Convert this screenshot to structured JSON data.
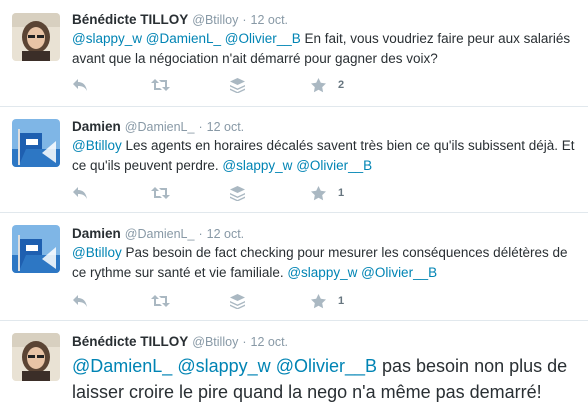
{
  "tweets": [
    {
      "name": "Bénédicte TILLOY",
      "handle": "@Btilloy",
      "time": "12 oct.",
      "text_parts": [
        {
          "t": "@slappy_w",
          "mention": true
        },
        {
          "t": " ",
          "mention": false
        },
        {
          "t": "@DamienL_",
          "mention": true
        },
        {
          "t": " ",
          "mention": false
        },
        {
          "t": "@Olivier__B",
          "mention": true
        },
        {
          "t": " En fait, vous voudriez faire peur aux salariés avant que la négociation n'ait démarré pour gagner des voix?",
          "mention": false
        }
      ],
      "favorite_count": "2",
      "retweet_count": "",
      "avatar": "woman-avatar",
      "large": false
    },
    {
      "name": "Damien",
      "handle": "@DamienL_",
      "time": "12 oct.",
      "text_parts": [
        {
          "t": "@Btilloy",
          "mention": true
        },
        {
          "t": " Les agents en horaires décalés savent très bien ce qu'ils subissent déjà. Et ce qu'ils peuvent perdre. ",
          "mention": false
        },
        {
          "t": "@slappy_w",
          "mention": true
        },
        {
          "t": " ",
          "mention": false
        },
        {
          "t": "@Olivier__B",
          "mention": true
        }
      ],
      "favorite_count": "1",
      "retweet_count": "",
      "avatar": "flag-avatar",
      "large": false
    },
    {
      "name": "Damien",
      "handle": "@DamienL_",
      "time": "12 oct.",
      "text_parts": [
        {
          "t": "@Btilloy",
          "mention": true
        },
        {
          "t": " Pas besoin de fact checking pour mesurer les conséquences délétères de ce rythme sur santé et vie familiale. ",
          "mention": false
        },
        {
          "t": "@slappy_w",
          "mention": true
        },
        {
          "t": " ",
          "mention": false
        },
        {
          "t": "@Olivier__B",
          "mention": true
        }
      ],
      "favorite_count": "1",
      "retweet_count": "",
      "avatar": "flag-avatar",
      "large": false
    },
    {
      "name": "Bénédicte TILLOY",
      "handle": "@Btilloy",
      "time": "12 oct.",
      "text_parts": [
        {
          "t": "@DamienL_",
          "mention": true
        },
        {
          "t": " ",
          "mention": false
        },
        {
          "t": "@slappy_w",
          "mention": true
        },
        {
          "t": " ",
          "mention": false
        },
        {
          "t": "@Olivier__B",
          "mention": true
        },
        {
          "t": " pas besoin non plus de laisser croire le pire quand la nego n'a même pas demarré!",
          "mention": false
        }
      ],
      "favorite_count": "",
      "retweet_count": "",
      "avatar": "woman-avatar",
      "large": true
    }
  ],
  "icons": [
    "reply-icon",
    "retweet-icon",
    "stack-icon",
    "favorite-icon",
    "more-icon"
  ],
  "colors": {
    "mention": "#0084b4",
    "icon": "#aab8c2",
    "separator": "#e1e8ed",
    "text": "#292f33",
    "meta": "#8899a6"
  }
}
